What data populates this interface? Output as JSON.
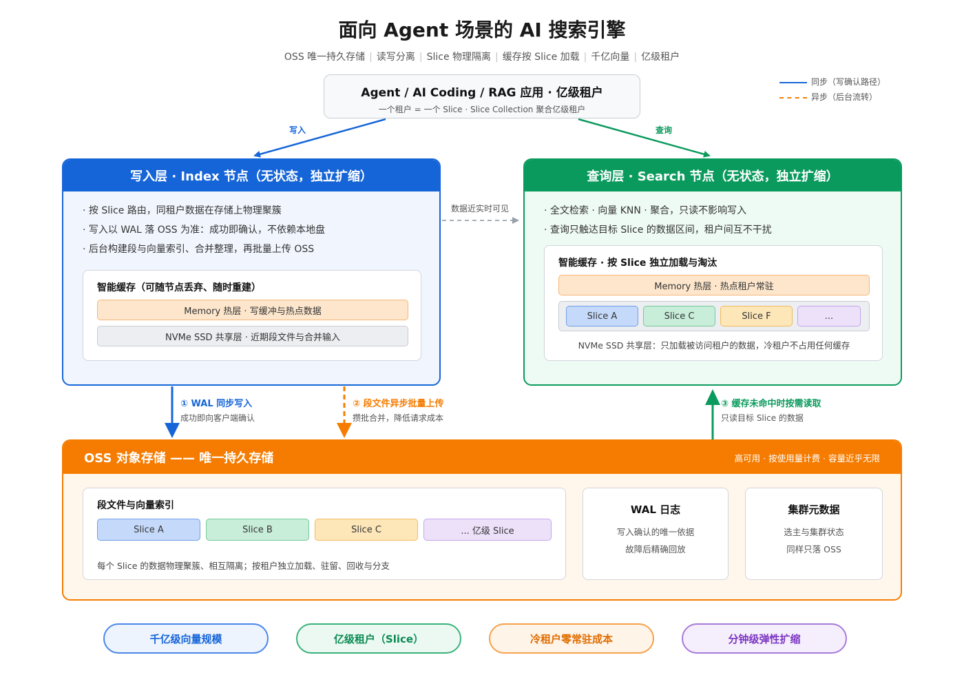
{
  "title": "面向 Agent 场景的 AI 搜索引擎",
  "subtitle_items": [
    "OSS 唯一持久存储",
    "读写分离",
    "Slice 物理隔离",
    "缓存按 Slice 加载",
    "千亿向量",
    "亿级租户"
  ],
  "legend": {
    "sync": "同步（写确认路径）",
    "async": "异步（后台流转）"
  },
  "top_box": {
    "title": "Agent / AI Coding / RAG 应用 · 亿级租户",
    "subtitle": "一个租户 = 一个 Slice · Slice Collection 聚合亿级租户"
  },
  "edges": {
    "write": "写入",
    "query": "查询",
    "near_realtime": "数据近实时可见"
  },
  "write_layer": {
    "title": "写入层 · Index 节点（无状态，独立扩缩）",
    "bullets": [
      "· 按 Slice 路由，同租户数据在存储上物理聚簇",
      "· 写入以 WAL 落 OSS 为准：成功即确认，不依赖本地盘",
      "· 后台构建段与向量索引、合并整理，再批量上传 OSS"
    ],
    "cache": {
      "title": "智能缓存（可随节点丢弃、随时重建）",
      "memory": "Memory 热层 · 写缓冲与热点数据",
      "nvme": "NVMe SSD 共享层 · 近期段文件与合并输入"
    }
  },
  "query_layer": {
    "title": "查询层 · Search 节点（无状态，独立扩缩）",
    "bullets": [
      "· 全文检索 · 向量 KNN · 聚合，只读不影响写入",
      "· 查询只触达目标 Slice 的数据区间，租户间互不干扰"
    ],
    "cache": {
      "title": "智能缓存 · 按 Slice 独立加载与淘汰",
      "memory": "Memory 热层 · 热点租户常驻",
      "slices": [
        "Slice A",
        "Slice C",
        "Slice F",
        "..."
      ],
      "nvme": "NVMe SSD 共享层：只加载被访问租户的数据，冷租户不占用任何缓存"
    }
  },
  "flows": {
    "wal": {
      "title": "① WAL 同步写入",
      "desc": "成功即向客户端确认"
    },
    "segment": {
      "title": "② 段文件异步批量上传",
      "desc": "攒批合并，降低请求成本"
    },
    "miss": {
      "title": "③ 缓存未命中时按需读取",
      "desc": "只读目标 Slice 的数据"
    }
  },
  "oss": {
    "title": "OSS 对象存储 —— 唯一持久存储",
    "right_note": "高可用 · 按使用量计费 · 容量近乎无限",
    "segments": {
      "title": "段文件与向量索引",
      "slices": [
        "Slice A",
        "Slice B",
        "Slice C",
        "... 亿级 Slice"
      ],
      "note": "每个 Slice 的数据物理聚簇、相互隔离；按租户独立加载、驻留、回收与分支"
    },
    "wal_log": {
      "title": "WAL 日志",
      "line1": "写入确认的唯一依据",
      "line2": "故障后精确回放"
    },
    "metadata": {
      "title": "集群元数据",
      "line1": "选主与集群状态",
      "line2": "同样只落 OSS"
    }
  },
  "footer_pills": [
    "千亿级向量规模",
    "亿级租户（Slice）",
    "冷租户零常驻成本",
    "分钟级弹性扩缩"
  ],
  "colors": {
    "blue": "#1565d8",
    "green": "#0b9a5d",
    "orange": "#f57c00",
    "purple": "#8e44c9"
  }
}
